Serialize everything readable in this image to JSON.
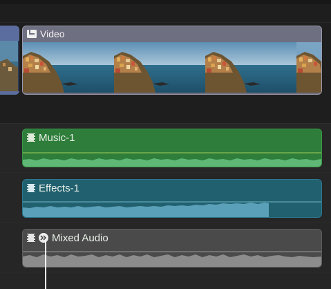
{
  "timeline": {
    "video_clip": {
      "label": "Video",
      "icon": "connected-clip-icon"
    },
    "audio_clips": [
      {
        "label": "Music-1",
        "icon": "filmstrip-icon",
        "color": "#2e7d3a"
      },
      {
        "label": "Effects-1",
        "icon": "filmstrip-icon",
        "color": "#21606f"
      },
      {
        "label": "Mixed Audio",
        "icon": "filmstrip-icon",
        "secondary_icon": "compound-clip-icon",
        "color": "#4a4a4a"
      }
    ]
  },
  "colors": {
    "background": "#1f1f1f",
    "video_clip": "#6f6f82",
    "music": "#2e7d3a",
    "effects": "#21606f",
    "mixed": "#4a4a4a",
    "playhead": "#ffffff"
  }
}
